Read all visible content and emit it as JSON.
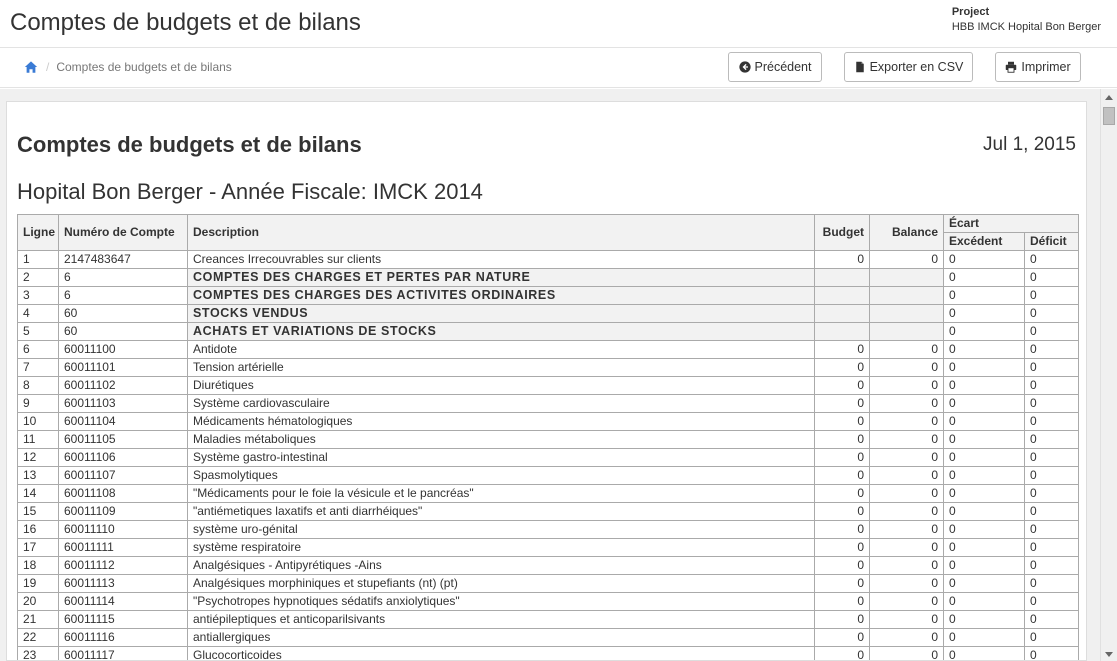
{
  "header": {
    "title": "Comptes de budgets et de bilans",
    "project_label": "Project",
    "project_name": "HBB IMCK Hopital Bon Berger"
  },
  "breadcrumb": {
    "current": "Comptes de budgets et de bilans"
  },
  "toolbar": {
    "previous_label": "Précédent",
    "export_label": "Exporter en CSV",
    "print_label": "Imprimer"
  },
  "report": {
    "title": "Comptes de budgets et de bilans",
    "date": "Jul 1, 2015",
    "subtitle": "Hopital Bon Berger - Année Fiscale: IMCK 2014"
  },
  "table": {
    "headers": {
      "ligne": "Ligne",
      "account": "Numéro de Compte",
      "description": "Description",
      "budget": "Budget",
      "balance": "Balance",
      "ecart": "Écart",
      "excedent": "Excédent",
      "deficit": "Déficit"
    },
    "rows": [
      {
        "ligne": "1",
        "account": "2147483647",
        "description": "Creances Irrecouvrables sur clients",
        "budget": "0",
        "balance": "0",
        "excedent": "0",
        "deficit": "0",
        "header": false
      },
      {
        "ligne": "2",
        "account": "6",
        "description": "COMPTES DES CHARGES ET PERTES PAR NATURE",
        "budget": "",
        "balance": "",
        "excedent": "0",
        "deficit": "0",
        "header": true
      },
      {
        "ligne": "3",
        "account": "6",
        "description": "COMPTES DES CHARGES DES ACTIVITES ORDINAIRES",
        "budget": "",
        "balance": "",
        "excedent": "0",
        "deficit": "0",
        "header": true
      },
      {
        "ligne": "4",
        "account": "60",
        "description": "STOCKS VENDUS",
        "budget": "",
        "balance": "",
        "excedent": "0",
        "deficit": "0",
        "header": true
      },
      {
        "ligne": "5",
        "account": "60",
        "description": "ACHATS ET VARIATIONS DE STOCKS",
        "budget": "",
        "balance": "",
        "excedent": "0",
        "deficit": "0",
        "header": true
      },
      {
        "ligne": "6",
        "account": "60011100",
        "description": "Antidote",
        "budget": "0",
        "balance": "0",
        "excedent": "0",
        "deficit": "0",
        "header": false
      },
      {
        "ligne": "7",
        "account": "60011101",
        "description": "Tension artérielle",
        "budget": "0",
        "balance": "0",
        "excedent": "0",
        "deficit": "0",
        "header": false
      },
      {
        "ligne": "8",
        "account": "60011102",
        "description": "Diurétiques",
        "budget": "0",
        "balance": "0",
        "excedent": "0",
        "deficit": "0",
        "header": false
      },
      {
        "ligne": "9",
        "account": "60011103",
        "description": "Système cardiovasculaire",
        "budget": "0",
        "balance": "0",
        "excedent": "0",
        "deficit": "0",
        "header": false
      },
      {
        "ligne": "10",
        "account": "60011104",
        "description": "Médicaments hématologiques",
        "budget": "0",
        "balance": "0",
        "excedent": "0",
        "deficit": "0",
        "header": false
      },
      {
        "ligne": "11",
        "account": "60011105",
        "description": "Maladies métaboliques",
        "budget": "0",
        "balance": "0",
        "excedent": "0",
        "deficit": "0",
        "header": false
      },
      {
        "ligne": "12",
        "account": "60011106",
        "description": "Système gastro-intestinal",
        "budget": "0",
        "balance": "0",
        "excedent": "0",
        "deficit": "0",
        "header": false
      },
      {
        "ligne": "13",
        "account": "60011107",
        "description": "Spasmolytiques",
        "budget": "0",
        "balance": "0",
        "excedent": "0",
        "deficit": "0",
        "header": false
      },
      {
        "ligne": "14",
        "account": "60011108",
        "description": "\"Médicaments pour le foie la vésicule et le pancréas\"",
        "budget": "0",
        "balance": "0",
        "excedent": "0",
        "deficit": "0",
        "header": false
      },
      {
        "ligne": "15",
        "account": "60011109",
        "description": "\"antiémetiques laxatifs et anti diarrhéiques\"",
        "budget": "0",
        "balance": "0",
        "excedent": "0",
        "deficit": "0",
        "header": false
      },
      {
        "ligne": "16",
        "account": "60011110",
        "description": "système uro-génital",
        "budget": "0",
        "balance": "0",
        "excedent": "0",
        "deficit": "0",
        "header": false
      },
      {
        "ligne": "17",
        "account": "60011111",
        "description": "système respiratoire",
        "budget": "0",
        "balance": "0",
        "excedent": "0",
        "deficit": "0",
        "header": false
      },
      {
        "ligne": "18",
        "account": "60011112",
        "description": "Analgésiques - Antipyrétiques -Ains",
        "budget": "0",
        "balance": "0",
        "excedent": "0",
        "deficit": "0",
        "header": false
      },
      {
        "ligne": "19",
        "account": "60011113",
        "description": "Analgésiques morphiniques et stupefiants (nt) (pt)",
        "budget": "0",
        "balance": "0",
        "excedent": "0",
        "deficit": "0",
        "header": false
      },
      {
        "ligne": "20",
        "account": "60011114",
        "description": "\"Psychotropes hypnotiques sédatifs anxiolytiques\"",
        "budget": "0",
        "balance": "0",
        "excedent": "0",
        "deficit": "0",
        "header": false
      },
      {
        "ligne": "21",
        "account": "60011115",
        "description": "antiépileptiques et anticoparilsivants",
        "budget": "0",
        "balance": "0",
        "excedent": "0",
        "deficit": "0",
        "header": false
      },
      {
        "ligne": "22",
        "account": "60011116",
        "description": "antiallergiques",
        "budget": "0",
        "balance": "0",
        "excedent": "0",
        "deficit": "0",
        "header": false
      },
      {
        "ligne": "23",
        "account": "60011117",
        "description": "Glucocorticoides",
        "budget": "0",
        "balance": "0",
        "excedent": "0",
        "deficit": "0",
        "header": false
      }
    ]
  }
}
